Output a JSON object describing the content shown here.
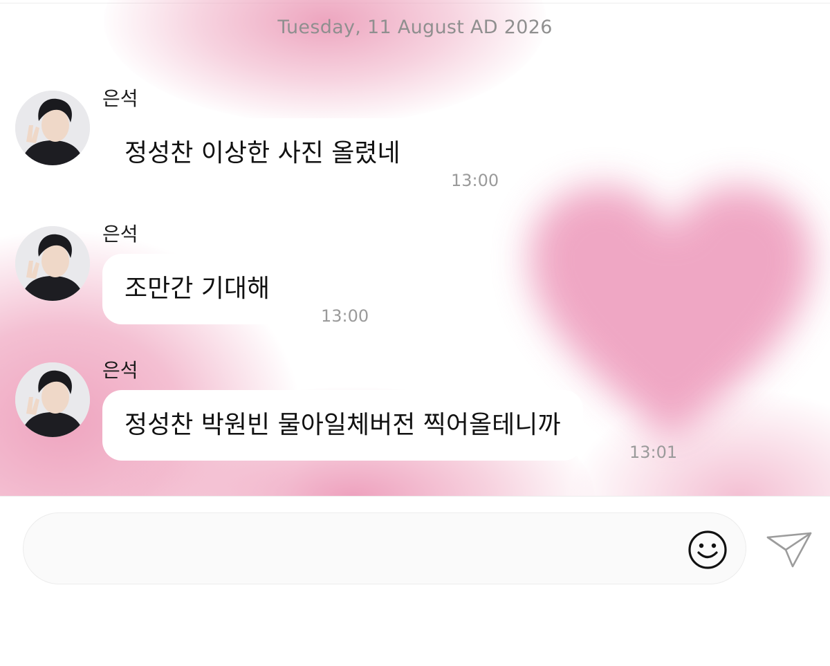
{
  "date_separator": "Tuesday, 11 August AD 2026",
  "messages": [
    {
      "sender": "은석",
      "text": "정성찬 이상한 사진 올렸네",
      "time": "13:00"
    },
    {
      "sender": "은석",
      "text": "조만간 기대해",
      "time": "13:00"
    },
    {
      "sender": "은석",
      "text": "정성찬 박원빈 물아일체버전 찍어올테니까",
      "time": "13:01"
    }
  ],
  "composer": {
    "placeholder": "",
    "value": ""
  },
  "icons": {
    "avatar": "profile-photo",
    "emoji": "smiley-face-icon",
    "send": "paper-plane-icon"
  },
  "colors": {
    "wallpaper_pink": "#ee9fbd",
    "bubble": "#ffffff",
    "timestamp": "#9a9a9a",
    "date_text": "#8f8f8f"
  }
}
